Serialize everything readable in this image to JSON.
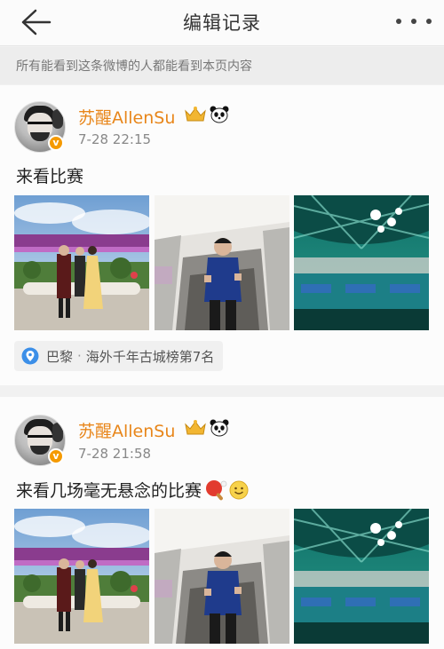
{
  "header": {
    "title": "编辑记录",
    "back_icon": "back-arrow-icon",
    "more_icon": "more-dots-icon"
  },
  "notice": "所有能看到这条微博的人都能看到本页内容",
  "posts": [
    {
      "username": "苏醒AllenSu",
      "time": "7-28 22:15",
      "text": "来看比赛",
      "emoji": "",
      "badges": [
        "crown-icon",
        "panda-icon"
      ],
      "photos": [
        "tower-group-photo",
        "escalator-photo",
        "arena-photo"
      ],
      "location": {
        "city": "巴黎",
        "detail": "海外千年古城榜第7名"
      }
    },
    {
      "username": "苏醒AllenSu",
      "time": "7-28 21:58",
      "text": "来看几场毫无悬念的比赛",
      "emoji": "",
      "badges": [
        "crown-icon",
        "panda-icon"
      ],
      "photos": [
        "tower-group-photo",
        "escalator-photo",
        "arena-photo"
      ]
    }
  ],
  "colors": {
    "username": "#e8861a",
    "verified_badge": "#f59a00",
    "location_pin": "#3c8fe8",
    "background": "#f1f1f1"
  }
}
